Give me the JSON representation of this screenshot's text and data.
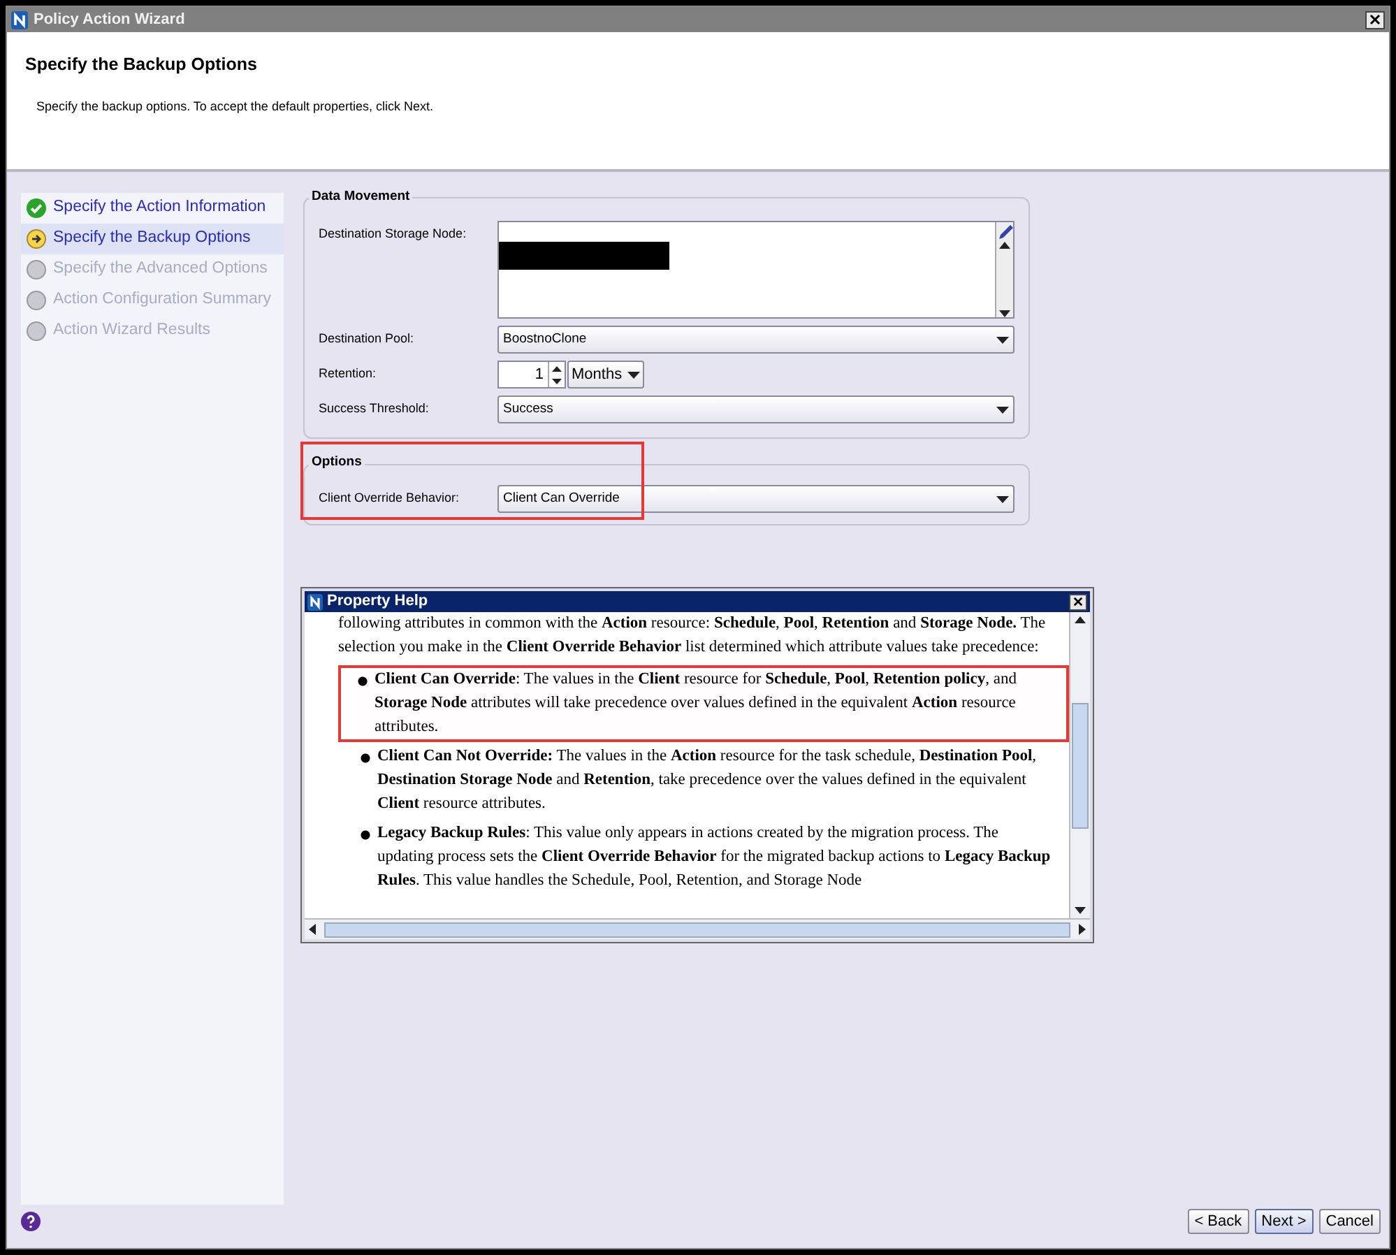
{
  "window": {
    "title": "Policy Action Wizard"
  },
  "header": {
    "title": "Specify the Backup Options",
    "description": "Specify the backup options. To accept the default properties, click Next."
  },
  "steps": [
    {
      "label": "Specify the Action Information",
      "kind": "done",
      "selected": false
    },
    {
      "label": "Specify the Backup Options",
      "kind": "current",
      "selected": true
    },
    {
      "label": "Specify the Advanced Options",
      "kind": "pending",
      "selected": false
    },
    {
      "label": "Action Configuration Summary",
      "kind": "pending",
      "selected": false
    },
    {
      "label": "Action Wizard Results",
      "kind": "pending",
      "selected": false
    }
  ],
  "data_movement": {
    "title": "Data Movement",
    "storage_node_label": "Destination Storage Node:",
    "pool_label": "Destination Pool:",
    "pool_value": "BoostnoClone",
    "retention_label": "Retention:",
    "retention_value": "1",
    "retention_unit": "Months",
    "threshold_label": "Success Threshold:",
    "threshold_value": "Success"
  },
  "options": {
    "title": "Options",
    "override_label": "Client Override Behavior:",
    "override_value": "Client Can Override",
    "highlighted": true
  },
  "property_help": {
    "title": "Property Help",
    "intro": "following attributes in common with the **Action** resource: **Schedule**, **Pool**, **Retention** and **Storage Node.**  The selection you make in the **Client Override Behavior** list determined which attribute values take precedence:",
    "bullets": [
      {
        "text": "**Client Can Override**:  The values in the **Client** resource for **Schedule**, **Pool**, **Retention policy**, and **Storage Node** attributes will take precedence over values defined in the equivalent **Action** resource attributes.",
        "highlighted": true
      },
      {
        "text": "**Client Can Not Override:** The values in the **Action** resource for the task schedule, **Destination Pool**, **Destination Storage Node** and **Retention**, take precedence over the values defined in the equivalent **Client** resource attributes.",
        "highlighted": false
      },
      {
        "text": "**Legacy Backup Rules**: This value only appears in actions created by the migration process. The updating process sets the **Client Override Behavior** for the migrated backup actions to **Legacy Backup Rules**. This value handles the Schedule, Pool, Retention, and Storage Node",
        "highlighted": false
      }
    ]
  },
  "buttons": [
    {
      "label": "< Back",
      "kind": "normal"
    },
    {
      "label": "Next >",
      "kind": "default"
    },
    {
      "label": "Cancel",
      "kind": "normal"
    }
  ]
}
